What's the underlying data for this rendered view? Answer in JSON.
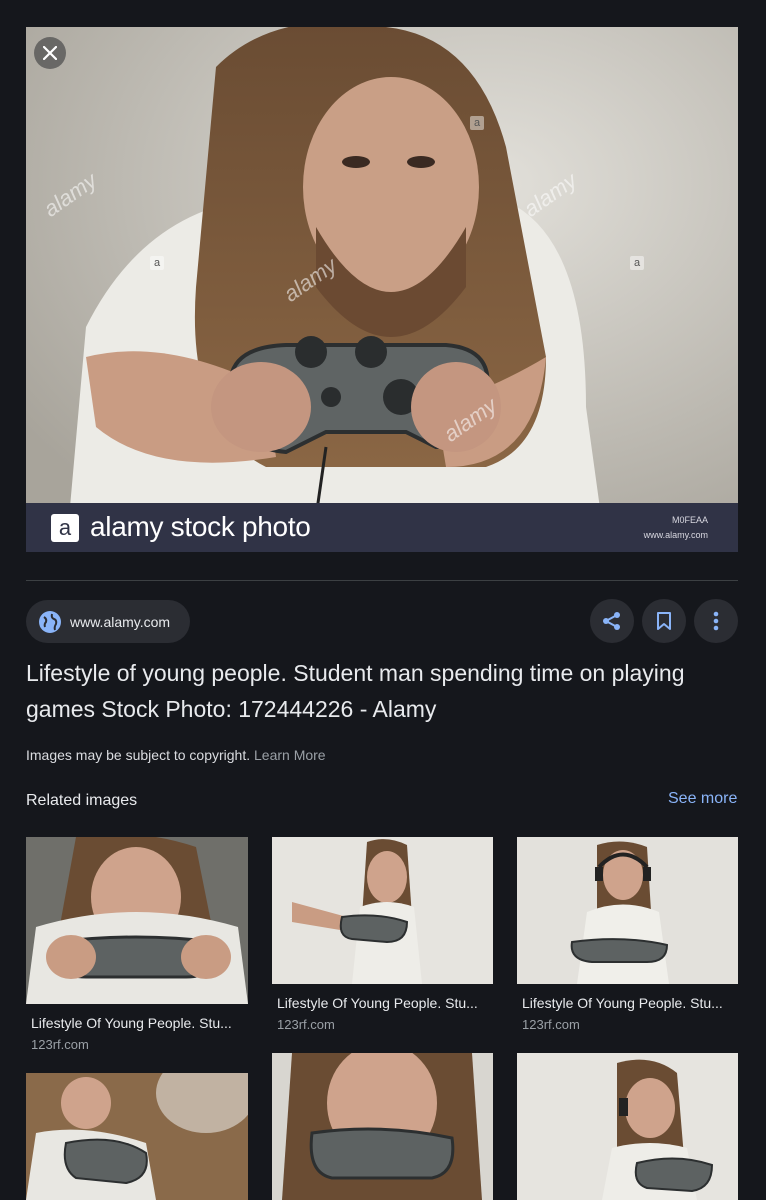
{
  "main_image": {
    "caption_brand": "alamy stock photo",
    "logo_letter": "a",
    "image_id": "M0FEAA",
    "image_site": "www.alamy.com",
    "watermark_text": "alamy",
    "watermark_letter": "a"
  },
  "source": {
    "site": "www.alamy.com",
    "icon": "globe-icon"
  },
  "actions": [
    {
      "name": "share",
      "icon": "share-icon"
    },
    {
      "name": "save",
      "icon": "bookmark-icon"
    },
    {
      "name": "more",
      "icon": "more-vert-icon"
    }
  ],
  "title": "Lifestyle of young people. Student man spending time on playing games Stock Photo: 172444226 - Alamy",
  "copyright": {
    "text": "Images may be subject to copyright.",
    "link": "Learn More"
  },
  "related": {
    "heading": "Related images",
    "see_more": "See more",
    "items": [
      {
        "title": "Lifestyle Of Young People. Stu...",
        "source": "123rf.com"
      },
      {
        "title": "Lifestyle Of Young People. Stu...",
        "source": "123rf.com"
      },
      {
        "title": "Lifestyle Of Young People. Stu...",
        "source": "123rf.com"
      }
    ]
  },
  "colors": {
    "background": "#15171c",
    "accent_link": "#8ab4f8",
    "caption_bar": "#303346",
    "button_bg": "#2b2d33"
  }
}
